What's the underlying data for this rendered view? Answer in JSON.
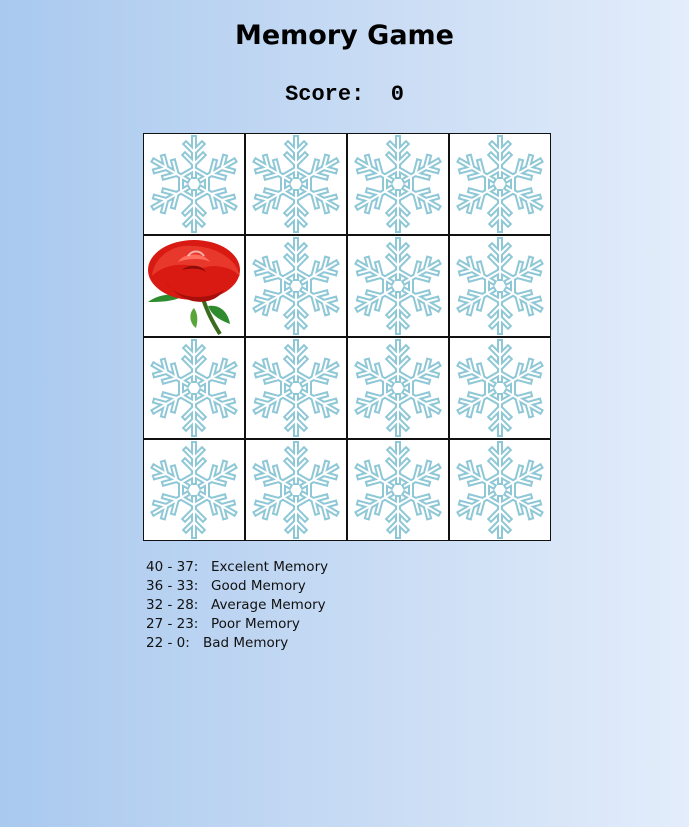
{
  "title": "Memory Game",
  "score": {
    "label": "Score:",
    "value": "0"
  },
  "board": {
    "rows": 4,
    "cols": 4,
    "cards": [
      {
        "face": "snowflake-icon",
        "revealed": false
      },
      {
        "face": "snowflake-icon",
        "revealed": false
      },
      {
        "face": "snowflake-icon",
        "revealed": false
      },
      {
        "face": "snowflake-icon",
        "revealed": false
      },
      {
        "face": "rose-icon",
        "revealed": true
      },
      {
        "face": "snowflake-icon",
        "revealed": false
      },
      {
        "face": "snowflake-icon",
        "revealed": false
      },
      {
        "face": "snowflake-icon",
        "revealed": false
      },
      {
        "face": "snowflake-icon",
        "revealed": false
      },
      {
        "face": "snowflake-icon",
        "revealed": false
      },
      {
        "face": "snowflake-icon",
        "revealed": false
      },
      {
        "face": "snowflake-icon",
        "revealed": false
      },
      {
        "face": "snowflake-icon",
        "revealed": false
      },
      {
        "face": "snowflake-icon",
        "revealed": false
      },
      {
        "face": "snowflake-icon",
        "revealed": false
      },
      {
        "face": "snowflake-icon",
        "revealed": false
      }
    ]
  },
  "legend": [
    {
      "range": "40 - 37:",
      "label": "Excelent Memory"
    },
    {
      "range": "36 - 33:",
      "label": "Good Memory"
    },
    {
      "range": "32 - 28:",
      "label": "Average Memory"
    },
    {
      "range": "27 - 23:",
      "label": "Poor Memory"
    },
    {
      "range": "22 - 0:",
      "label": "Bad Memory"
    }
  ],
  "colors": {
    "snowflake": "#8ec7d6",
    "rose": "#d81a12",
    "leaf": "#2e8b2e",
    "card_border": "#111111"
  }
}
